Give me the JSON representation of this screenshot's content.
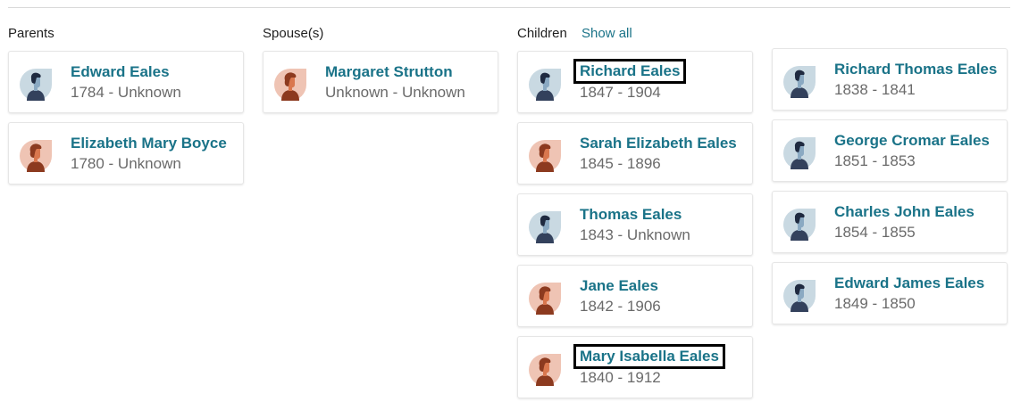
{
  "sections": {
    "parents": "Parents",
    "spouses": "Spouse(s)",
    "children": "Children",
    "show_all": "Show all"
  },
  "parents": [
    {
      "name": "Edward Eales",
      "dates": "1784 - Unknown",
      "gender": "male"
    },
    {
      "name": "Elizabeth Mary Boyce",
      "dates": "1780 - Unknown",
      "gender": "female"
    }
  ],
  "spouses": [
    {
      "name": "Margaret Strutton",
      "dates": "Unknown - Unknown",
      "gender": "female"
    }
  ],
  "children_col1": [
    {
      "name": "Richard Eales",
      "dates": "1847 - 1904",
      "gender": "male",
      "highlighted": true
    },
    {
      "name": "Sarah Elizabeth Eales",
      "dates": "1845 - 1896",
      "gender": "female",
      "highlighted": false
    },
    {
      "name": "Thomas Eales",
      "dates": "1843 - Unknown",
      "gender": "male",
      "highlighted": false
    },
    {
      "name": "Jane Eales",
      "dates": "1842 - 1906",
      "gender": "female",
      "highlighted": false
    },
    {
      "name": "Mary Isabella Eales",
      "dates": "1840 - 1912",
      "gender": "female",
      "highlighted": true
    }
  ],
  "children_col2": [
    {
      "name": "Richard Thomas Eales",
      "dates": "1838 - 1841",
      "gender": "male"
    },
    {
      "name": "George Cromar Eales",
      "dates": "1851 - 1853",
      "gender": "male"
    },
    {
      "name": "Charles John Eales",
      "dates": "1854 - 1855",
      "gender": "male"
    },
    {
      "name": "Edward James Eales",
      "dates": "1849 - 1850",
      "gender": "male"
    }
  ],
  "colors": {
    "link": "#1a7388",
    "muted": "#6a6a6a",
    "male_bg": "#c9d9e2",
    "female_bg": "#efc4b4"
  }
}
